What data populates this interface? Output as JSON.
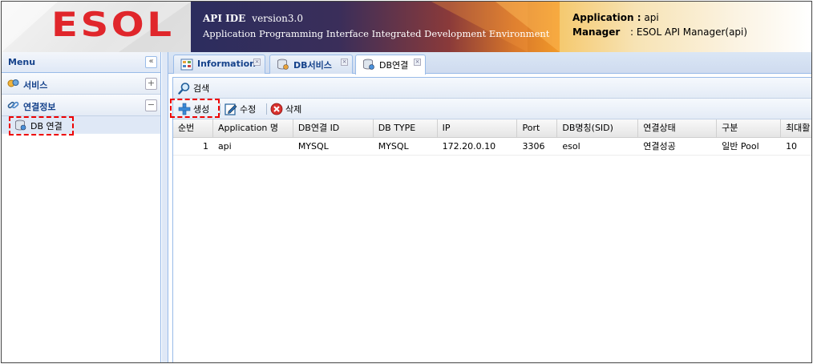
{
  "header": {
    "logo_text": "ESOL",
    "title_main": "API IDE",
    "version": "version3.0",
    "subtitle": "Application Programming Interface Integrated Development Environment",
    "application_label": "Application :",
    "application_value": "api",
    "manager_label": "Manager",
    "manager_value": ": ESOL API Manager(api)"
  },
  "sidebar": {
    "title": "Menu",
    "collapse_icon": "double-chevron-left",
    "sections": [
      {
        "label": "서비스",
        "toggle": "+",
        "icon": "service-icon"
      },
      {
        "label": "연결정보",
        "toggle": "−",
        "icon": "link-icon",
        "items": [
          {
            "label": "DB 연결",
            "icon": "database-icon"
          }
        ]
      }
    ]
  },
  "tabs": [
    {
      "label": "Information",
      "icon": "grid-icon"
    },
    {
      "label": "DB서비스",
      "icon": "database-icon"
    },
    {
      "label": "DB연결",
      "icon": "database-icon",
      "active": true
    }
  ],
  "search_toolbar": {
    "search_label": "검색"
  },
  "action_toolbar": {
    "create_label": "생성",
    "edit_label": "수정",
    "delete_label": "삭제"
  },
  "table": {
    "columns": [
      "순번",
      "Application 명",
      "DB연결 ID",
      "DB TYPE",
      "IP",
      "Port",
      "DB명칭(SID)",
      "연결상태",
      "구분",
      "최대활"
    ],
    "rows": [
      [
        "1",
        "api",
        "MYSQL",
        "MYSQL",
        "172.20.0.10",
        "3306",
        "esol",
        "연결성공",
        "일반 Pool",
        "10"
      ]
    ]
  },
  "colors": {
    "accent": "#15428b",
    "highlight": "#dd0000",
    "logo_red": "#e0262b"
  }
}
